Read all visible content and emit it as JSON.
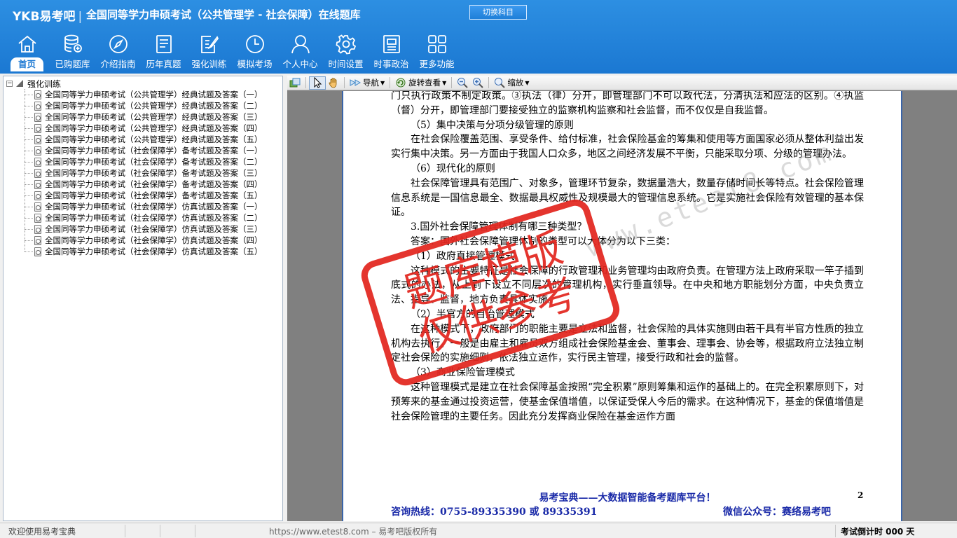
{
  "header": {
    "logo": "YKB易考吧",
    "title": "全国同等学力申硕考试（公共管理学 - 社会保障）在线题库",
    "switch_label": "切换科目"
  },
  "nav": [
    {
      "label": "首页",
      "icon": "home-icon"
    },
    {
      "label": "已购题库",
      "icon": "database-icon"
    },
    {
      "label": "介绍指南",
      "icon": "compass-icon"
    },
    {
      "label": "历年真题",
      "icon": "document-list-icon"
    },
    {
      "label": "强化训练",
      "icon": "edit-icon"
    },
    {
      "label": "模拟考场",
      "icon": "clock-icon"
    },
    {
      "label": "个人中心",
      "icon": "user-icon"
    },
    {
      "label": "时间设置",
      "icon": "gear-icon"
    },
    {
      "label": "时事政治",
      "icon": "news-icon"
    },
    {
      "label": "更多功能",
      "icon": "grid-icon"
    }
  ],
  "tree": {
    "root": "强化训练",
    "items": [
      "全国同等学力申硕考试（公共管理学）经典试题及答案（一）",
      "全国同等学力申硕考试（公共管理学）经典试题及答案（二）",
      "全国同等学力申硕考试（公共管理学）经典试题及答案（三）",
      "全国同等学力申硕考试（公共管理学）经典试题及答案（四）",
      "全国同等学力申硕考试（公共管理学）经典试题及答案（五）",
      "全国同等学力申硕考试（社会保障学）备考试题及答案（一）",
      "全国同等学力申硕考试（社会保障学）备考试题及答案（二）",
      "全国同等学力申硕考试（社会保障学）备考试题及答案（三）",
      "全国同等学力申硕考试（社会保障学）备考试题及答案（四）",
      "全国同等学力申硕考试（社会保障学）备考试题及答案（五）",
      "全国同等学力申硕考试（社会保障学）仿真试题及答案（一）",
      "全国同等学力申硕考试（社会保障学）仿真试题及答案（二）",
      "全国同等学力申硕考试（社会保障学）仿真试题及答案（三）",
      "全国同等学力申硕考试（社会保障学）仿真试题及答案（四）",
      "全国同等学力申硕考试（社会保障学）仿真试题及答案（五）"
    ]
  },
  "toolbar": {
    "nav_label": "导航",
    "rotate_label": "旋转查看",
    "zoom_label": "缩放"
  },
  "document": {
    "paragraphs": [
      {
        "cls": "",
        "text": "门只执行政策不制定政策。③执法（律）分开，即管理部门不可以政代法，分清执法和应法的区别。④执监（督）分开，即管理部门要接受独立的监察机构监察和社会监督，而不仅仅是自我监督。"
      },
      {
        "cls": "h",
        "text": "（5）集中决策与分项分级管理的原则"
      },
      {
        "cls": "ind",
        "text": "在社会保险覆盖范围、享受条件、给付标准，社会保险基金的筹集和使用等方面国家必须从整体利益出发实行集中决策。另一方面由于我国人口众多，地区之间经济发展不平衡，只能采取分项、分级的管理办法。"
      },
      {
        "cls": "h",
        "text": "（6）现代化的原则"
      },
      {
        "cls": "ind",
        "text": "社会保障管理具有范围广、对象多，管理环节复杂，数据量浩大，数量存储时间长等特点。社会保险管理信息系统是一国信息最全、数据最具权威性及规模最大的管理信息系统。它是实施社会保险有效管理的基本保证。"
      },
      {
        "cls": "h",
        "text": "3.国外社会保障管理体制有哪三种类型？"
      },
      {
        "cls": "ind",
        "text": "答案：国外社会保障管理体制的类型可以大体分为以下三类："
      },
      {
        "cls": "h",
        "text": "（1）政府直接管理模式"
      },
      {
        "cls": "ind",
        "text": "这种模式的主要特征是社会保障的行政管理和业务管理均由政府负责。在管理方法上政府采取一竿子插到底式的办法，从上到下设立不同层次的管理机构，实行垂直领导。在中央和地方职能划分方面，中央负责立法、指导、监督，地方负责具体实施。"
      },
      {
        "cls": "h",
        "text": "（2）半官方的自治管理模式"
      },
      {
        "cls": "ind",
        "text": "在这种模式下，政府部门的职能主要是立法和监督，社会保险的具体实施则由若干具有半官方性质的独立机构去执行。一般是由雇主和雇员双方组成社会保险基金会、董事会、理事会、协会等，根据政府立法独立制定社会保险的实施细则，依法独立运作，实行民主管理，接受行政和社会的监督。"
      },
      {
        "cls": "h",
        "text": "（3）商业保险管理模式"
      },
      {
        "cls": "ind",
        "text": "这种管理模式是建立在社会保障基金按照“完全积累”原则筹集和运作的基础上的。在完全积累原则下，对预筹来的基金通过投资运营，使基金保值增值，以保证受保人今后的需求。在这种情况下，基金的保值增值是社会保险管理的主要任务。因此充分发挥商业保险在基金运作方面"
      }
    ],
    "footer_slogan": "易考宝典——大数据智能备考题库平台！",
    "page_number": "2",
    "hotline": "咨询热线：0755-89335390 或 89335391",
    "wechat": "微信公众号：赛络易考吧",
    "watermark": "www.etest8.com",
    "stamp_line1": "题库模版",
    "stamp_line2": "仅供参考"
  },
  "status": {
    "left": "欢迎使用易考宝典",
    "mid": "https://www.etest8.com – 易考吧版权所有",
    "right": "考试倒计时 000 天"
  }
}
